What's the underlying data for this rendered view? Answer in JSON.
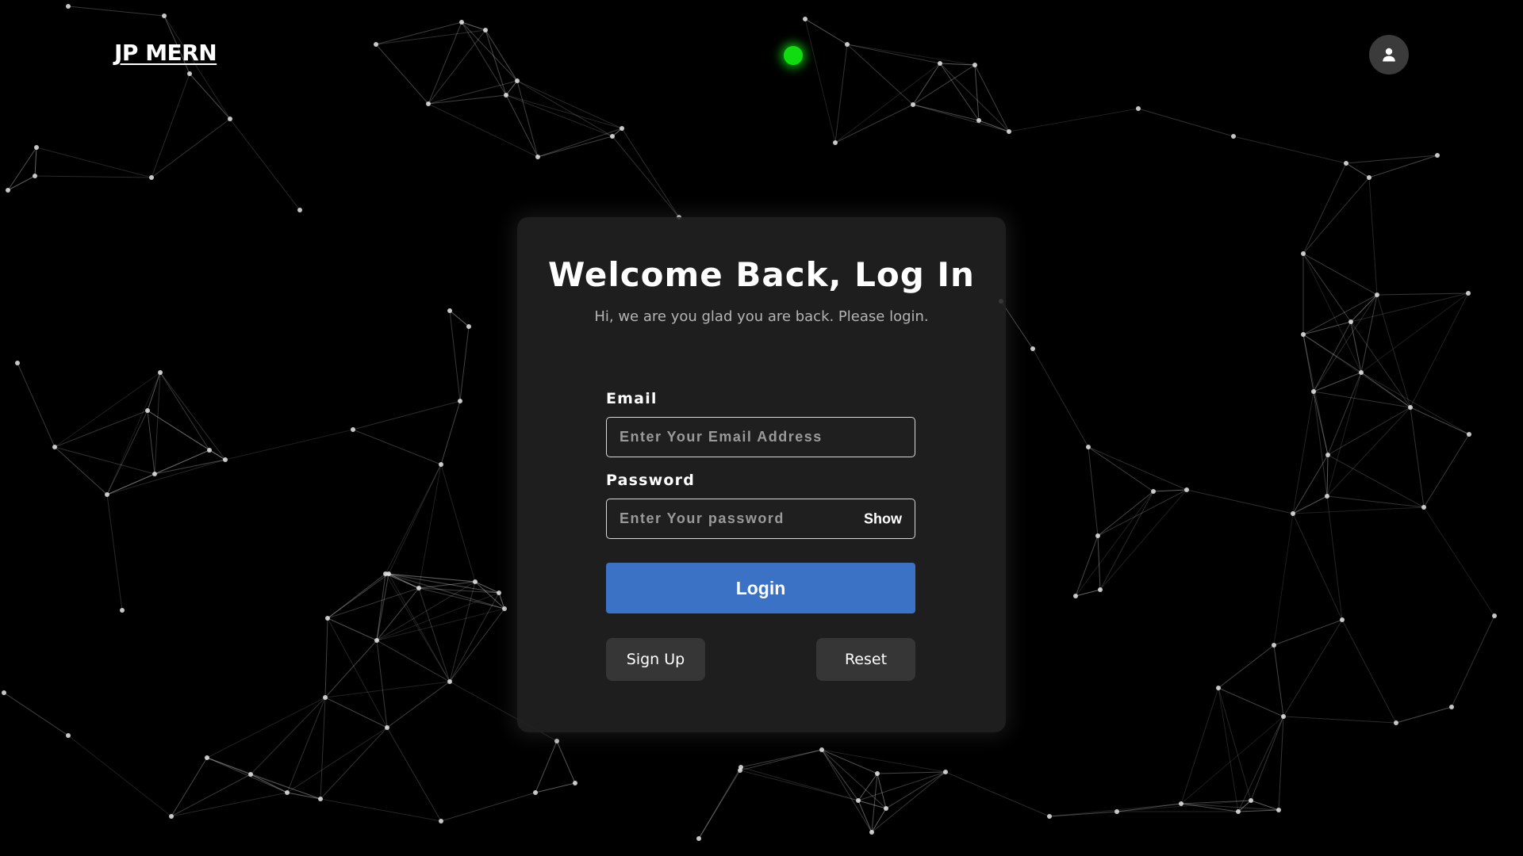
{
  "header": {
    "brand": "JP MERN",
    "status_indicator_color": "#10dc10",
    "avatar_icon": "user-icon"
  },
  "login_card": {
    "title": "Welcome Back, Log In",
    "subtitle": "Hi, we are you glad you are back. Please login.",
    "email": {
      "label": "Email",
      "placeholder": "Enter Your Email Address",
      "value": ""
    },
    "password": {
      "label": "Password",
      "placeholder": "Enter Your password",
      "value": "",
      "toggle_label": "Show"
    },
    "login_button": "Login",
    "signup_button": "Sign Up",
    "reset_button": "Reset"
  },
  "theme": {
    "background": "#000000",
    "card_background": "#222222",
    "primary_button": "#3b72c6",
    "secondary_button": "#363636"
  }
}
